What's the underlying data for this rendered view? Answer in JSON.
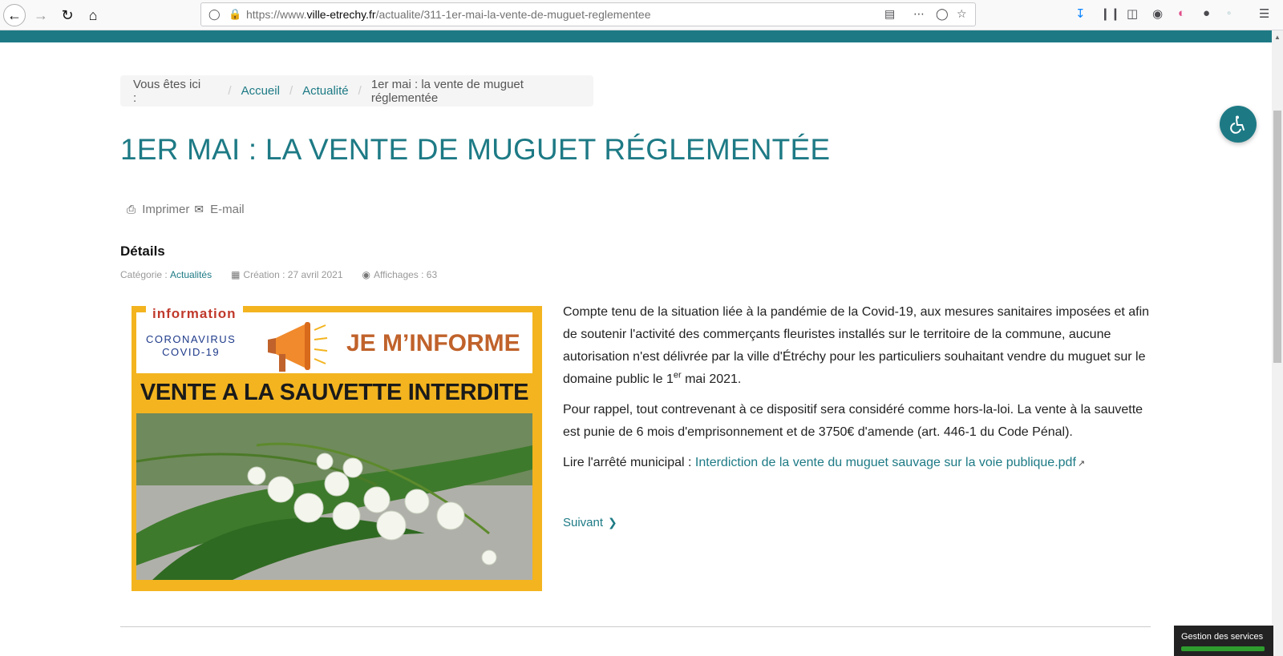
{
  "browser": {
    "url_prefix": "https://www.",
    "url_host": "ville-etrechy.fr",
    "url_path": "/actualite/311-1er-mai-la-vente-de-muguet-reglementee",
    "url_icons": [
      "shield-icon",
      "lock-icon"
    ],
    "toolbar_icons": [
      "download-icon",
      "library-icon",
      "sidebar-icon",
      "account-icon",
      "extension-icon",
      "extension-icon",
      "extension-icon",
      "menu-icon"
    ]
  },
  "breadcrumb": {
    "lead": "Vous êtes ici :",
    "items": [
      "Accueil",
      "Actualité"
    ],
    "current": "1er mai : la vente de muguet réglementée"
  },
  "article": {
    "title": "1ER MAI : LA VENTE DE MUGUET RÉGLEMENTÉE",
    "actions": {
      "print": "Imprimer",
      "email": "E-mail"
    },
    "details_heading": "Détails",
    "meta": {
      "category_label": "Catégorie :",
      "category_value": "Actualités",
      "created": "Création : 27 avril 2021",
      "views": "Affichages : 63"
    },
    "poster": {
      "tag": "information",
      "covid_line1": "CORONAVIRUS",
      "covid_line2": "COVID-19",
      "headline": "JE M’INFORME",
      "banner": "VENTE A LA SAUVETTE INTERDITE"
    },
    "paragraph1_a": "Compte tenu de la situation liée à la pandémie de la Covid-19, aux mesures sanitaires imposées et afin de soutenir l'activité des commerçants fleuristes installés sur le territoire de la commune, aucune autorisation n'est délivrée par la ville d'Étréchy pour les particuliers souhaitant vendre du muguet sur le domaine public le 1",
    "paragraph1_sup": "er",
    "paragraph1_b": " mai 2021.",
    "paragraph2": "Pour rappel, tout contrevenant à ce dispositif sera considéré comme hors-la-loi. La vente à la sauvette est punie de 6 mois d'emprisonnement et de 3750€ d'amende (art. 446-1 du Code Pénal).",
    "arrete_label": "Lire l'arrêté municipal : ",
    "arrete_link": "Interdiction de la vente du muguet sauvage sur la voie publique.pdf",
    "next": "Suivant"
  },
  "cookie_widget": {
    "label": "Gestion des services"
  },
  "colors": {
    "accent": "#1d7a85",
    "poster_yellow": "#f3b41f"
  }
}
